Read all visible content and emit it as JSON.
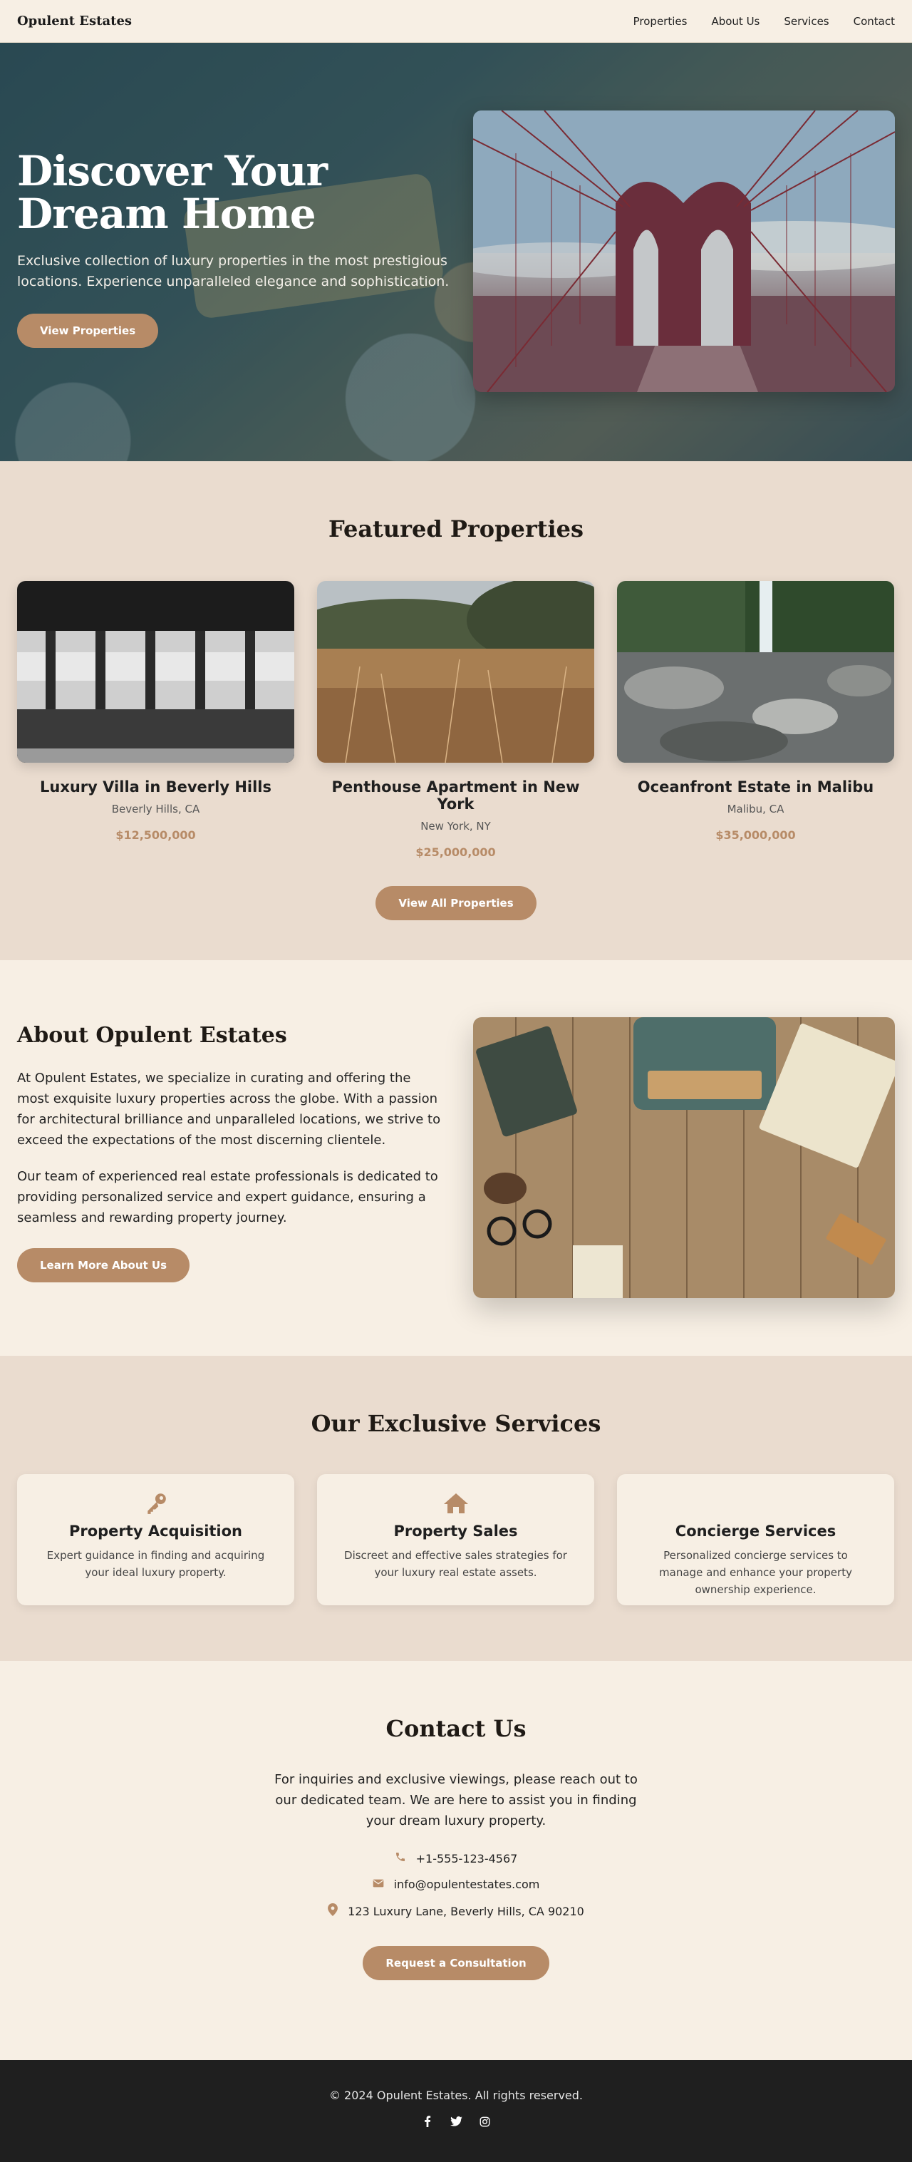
{
  "brand": "Opulent Estates",
  "nav": {
    "links": [
      "Properties",
      "About Us",
      "Services",
      "Contact"
    ]
  },
  "hero": {
    "title": "Discover Your Dream Home",
    "subtitle": "Exclusive collection of luxury properties in the most prestigious locations. Experience unparalleled elegance and sophistication.",
    "button": "View Properties"
  },
  "featured": {
    "title": "Featured Properties",
    "properties": [
      {
        "name": "Luxury Villa in Beverly Hills",
        "location": "Beverly Hills, CA",
        "price": "$12,500,000"
      },
      {
        "name": "Penthouse Apartment in New York",
        "location": "New York, NY",
        "price": "$25,000,000"
      },
      {
        "name": "Oceanfront Estate in Malibu",
        "location": "Malibu, CA",
        "price": "$35,000,000"
      }
    ],
    "button": "View All Properties"
  },
  "about": {
    "title": "About Opulent Estates",
    "p1": "At Opulent Estates, we specialize in curating and offering the most exquisite luxury properties across the globe. With a passion for architectural brilliance and unparalleled locations, we strive to exceed the expectations of the most discerning clientele.",
    "p2": "Our team of experienced real estate professionals is dedicated to providing personalized service and expert guidance, ensuring a seamless and rewarding property journey.",
    "button": "Learn More About Us"
  },
  "services": {
    "title": "Our Exclusive Services",
    "items": [
      {
        "icon": "key-icon",
        "title": "Property Acquisition",
        "desc": "Expert guidance in finding and acquiring your ideal luxury property."
      },
      {
        "icon": "home-icon",
        "title": "Property Sales",
        "desc": "Discreet and effective sales strategies for your luxury real estate assets."
      },
      {
        "icon": "",
        "title": "Concierge Services",
        "desc": "Personalized concierge services to manage and enhance your property ownership experience."
      }
    ]
  },
  "contact": {
    "title": "Contact Us",
    "text": "For inquiries and exclusive viewings, please reach out to our dedicated team. We are here to assist you in finding your dream luxury property.",
    "phone": "+1-555-123-4567",
    "email": "info@opulentestates.com",
    "address": "123 Luxury Lane, Beverly Hills, CA 90210",
    "button": "Request a Consultation"
  },
  "footer": {
    "text": "© 2024 Opulent Estates. All rights reserved.",
    "socials": [
      "facebook-icon",
      "twitter-icon",
      "instagram-icon"
    ]
  },
  "colors": {
    "accent": "#b78b67",
    "background": "#f7efe4",
    "section_alt": "#eadccf",
    "footer": "#1f1f1f"
  }
}
